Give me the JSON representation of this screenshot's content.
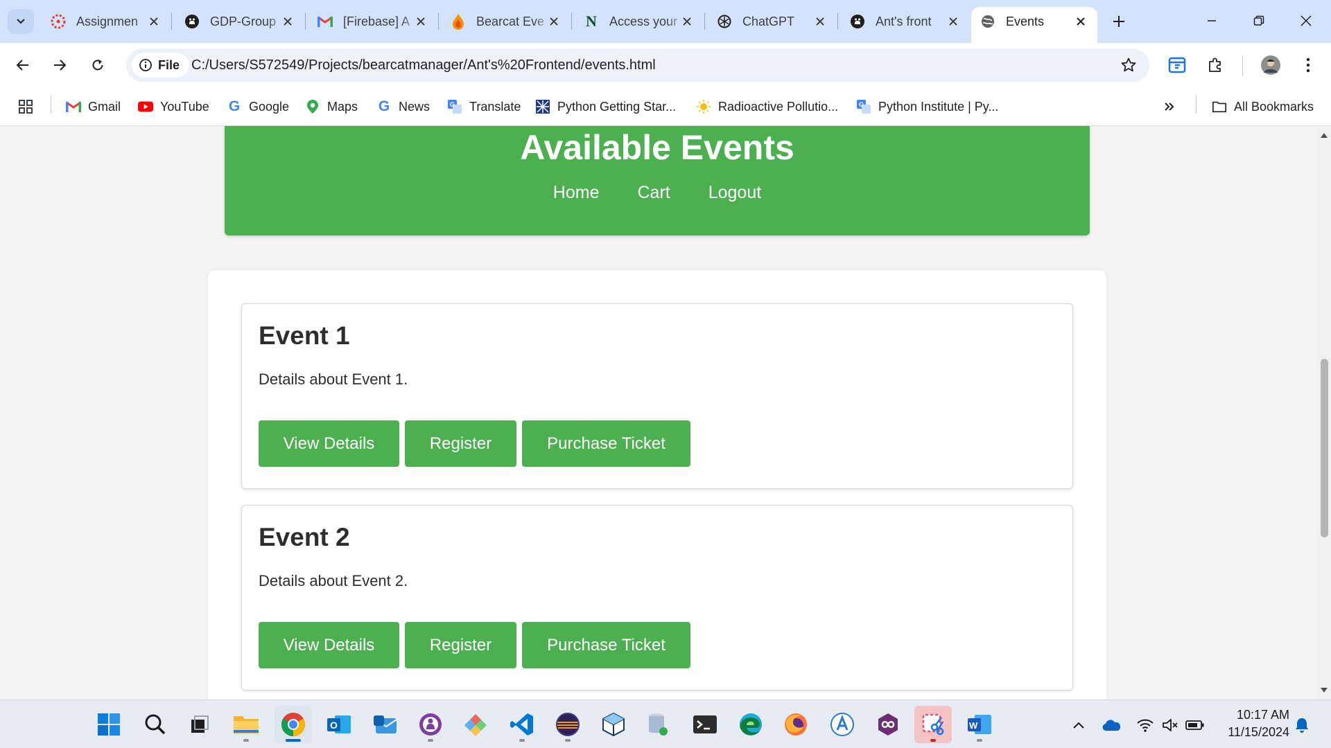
{
  "browser": {
    "tabs": [
      {
        "title": "Assignmen",
        "icon": "canvas-icon"
      },
      {
        "title": "GDP-Group",
        "icon": "github-icon"
      },
      {
        "title": "[Firebase] A",
        "icon": "gmail-icon"
      },
      {
        "title": "Bearcat Eve",
        "icon": "firebase-icon"
      },
      {
        "title": "Access your",
        "icon": "notion-icon"
      },
      {
        "title": "ChatGPT",
        "icon": "chatgpt-icon"
      },
      {
        "title": "Ant's front",
        "icon": "github-icon"
      },
      {
        "title": "Events",
        "icon": "globe-icon",
        "active": true
      }
    ],
    "site_chip_label": "File",
    "url": "C:/Users/S572549/Projects/bearcatmanager/Ant's%20Frontend/events.html",
    "bookmarks": [
      {
        "label": "Gmail",
        "icon": "gmail-icon"
      },
      {
        "label": "YouTube",
        "icon": "youtube-icon"
      },
      {
        "label": "Google",
        "icon": "google-icon"
      },
      {
        "label": "Maps",
        "icon": "maps-icon"
      },
      {
        "label": "News",
        "icon": "google-news-icon"
      },
      {
        "label": "Translate",
        "icon": "translate-icon"
      },
      {
        "label": "Python Getting Star...",
        "icon": "bookmark-site-icon"
      },
      {
        "label": "Radioactive Pollutio...",
        "icon": "sun-icon"
      },
      {
        "label": "Python Institute | Py...",
        "icon": "translate-icon"
      }
    ],
    "all_bookmarks_label": "All Bookmarks"
  },
  "page": {
    "title": "Available Events",
    "nav": [
      "Home",
      "Cart",
      "Logout"
    ],
    "events": [
      {
        "name": "Event 1",
        "details": "Details about Event 1."
      },
      {
        "name": "Event 2",
        "details": "Details about Event 2."
      }
    ],
    "buttons": {
      "view": "View Details",
      "register": "Register",
      "purchase": "Purchase Ticket"
    }
  },
  "taskbar": {
    "time": "10:17 AM",
    "date": "11/15/2024"
  },
  "colors": {
    "accent_green": "#4caf50",
    "tabstrip_blue": "#d3e3fd"
  }
}
